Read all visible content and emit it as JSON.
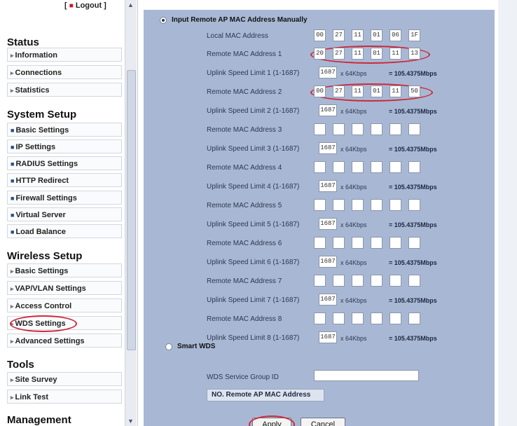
{
  "sidebar": {
    "logout": "Logout",
    "sections": [
      {
        "title": "Status",
        "items": [
          "Information",
          "Connections",
          "Statistics"
        ]
      },
      {
        "title": "System Setup",
        "items": [
          "Basic Settings",
          "IP Settings",
          "RADIUS Settings",
          "HTTP Redirect",
          "Firewall Settings",
          "Virtual Server",
          "Load Balance"
        ]
      },
      {
        "title": "Wireless Setup",
        "items": [
          "Basic Settings",
          "VAP/VLAN Settings",
          "Access Control",
          "WDS Settings",
          "Advanced Settings"
        ]
      },
      {
        "title": "Tools",
        "items": [
          "Site Survey",
          "Link Test"
        ]
      },
      {
        "title": "Management"
      }
    ]
  },
  "wds": {
    "manual_option": "Input Remote AP MAC Address Manually",
    "local_mac_label": "Local MAC Address",
    "local_mac": [
      "00",
      "27",
      "11",
      "01",
      "06",
      "1F"
    ],
    "remotes": [
      {
        "mac_label": "Remote MAC Address 1",
        "mac": [
          "20",
          "27",
          "11",
          "01",
          "11",
          "13"
        ],
        "speed_label": "Uplink Speed Limit 1 (1-1687)",
        "speed": "1687"
      },
      {
        "mac_label": "Remote MAC Address 2",
        "mac": [
          "00",
          "27",
          "11",
          "01",
          "11",
          "50"
        ],
        "speed_label": "Uplink Speed Limit 2 (1-1687)",
        "speed": "1687"
      },
      {
        "mac_label": "Remote MAC Address 3",
        "mac": [
          "",
          "",
          "",
          "",
          "",
          ""
        ],
        "speed_label": "Uplink Speed Limit 3 (1-1687)",
        "speed": "1687"
      },
      {
        "mac_label": "Remote MAC Address 4",
        "mac": [
          "",
          "",
          "",
          "",
          "",
          ""
        ],
        "speed_label": "Uplink Speed Limit 4 (1-1687)",
        "speed": "1687"
      },
      {
        "mac_label": "Remote MAC Address 5",
        "mac": [
          "",
          "",
          "",
          "",
          "",
          ""
        ],
        "speed_label": "Uplink Speed Limit 5 (1-1687)",
        "speed": "1687"
      },
      {
        "mac_label": "Remote MAC Address 6",
        "mac": [
          "",
          "",
          "",
          "",
          "",
          ""
        ],
        "speed_label": "Uplink Speed Limit 6 (1-1687)",
        "speed": "1687"
      },
      {
        "mac_label": "Remote MAC Address 7",
        "mac": [
          "",
          "",
          "",
          "",
          "",
          ""
        ],
        "speed_label": "Uplink Speed Limit 7 (1-1687)",
        "speed": "1687"
      },
      {
        "mac_label": "Remote MAC Address 8",
        "mac": [
          "",
          "",
          "",
          "",
          "",
          ""
        ],
        "speed_label": "Uplink Speed Limit 8 (1-1687)",
        "speed": "1687"
      }
    ],
    "speed_unit": "x 64Kbps",
    "speed_equals": "= 105.4375Mbps",
    "smart_option": "Smart WDS",
    "group_id_label": "WDS Service Group ID",
    "group_id_value": "",
    "table_header": "NO. Remote AP MAC Address",
    "apply_label": "Apply",
    "cancel_label": "Cancel"
  },
  "colors": {
    "panel_bg": "#a8b8d4",
    "highlight": "#cc2a3a",
    "logout_dot": "#d2102a"
  }
}
